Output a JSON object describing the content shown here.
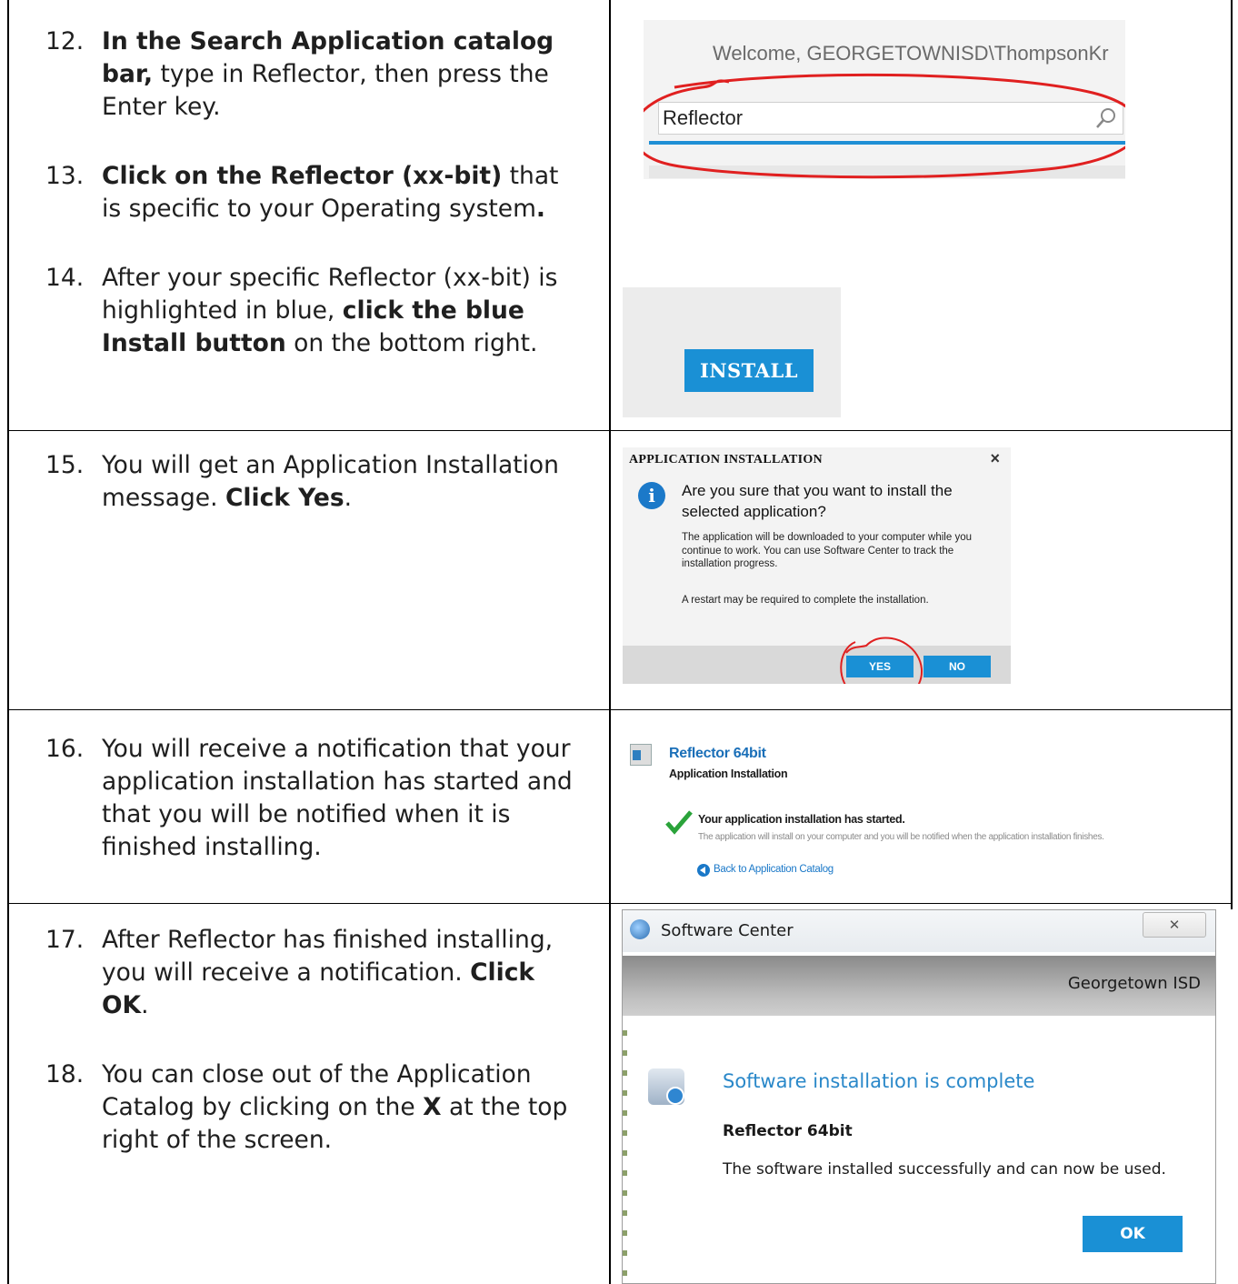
{
  "steps": {
    "s12": {
      "num": "12.",
      "bold": "In the Search Application catalog bar,",
      "rest": " type in Reflector, then press the Enter key."
    },
    "s13": {
      "num": "13.",
      "bold": "Click on the Reflector (xx-bit)",
      "rest": " that is specific to your Operating system",
      "end": "."
    },
    "s14": {
      "num": "14.",
      "pre": "After your specific Reflector (xx-bit) is highlighted in blue, ",
      "bold": "click the blue Install button",
      "rest": " on the bottom right."
    },
    "s15": {
      "num": "15.",
      "pre": "You will get an Application Installation message.  ",
      "bold": "Click Yes",
      "rest": "."
    },
    "s16": {
      "num": "16.",
      "text": "You will receive a notification that your application installation has started and that you will be notified when it is finished installing."
    },
    "s17": {
      "num": "17.",
      "pre": "After Reflector has finished installing, you will receive a notification.  ",
      "bold": "Click OK",
      "rest": "."
    },
    "s18": {
      "num": "18.",
      "pre": "You can close out of the Application Catalog by clicking on the ",
      "bold": "X",
      "rest": " at the top right of the screen."
    }
  },
  "search_shot": {
    "welcome": "Welcome, GEORGETOWNISD\\ThompsonKr",
    "input_value": "Reflector",
    "accent": "#1e8fd5",
    "annotation_color": "#e02020"
  },
  "install_shot": {
    "button": "INSTALL"
  },
  "dialog_shot": {
    "title": "APPLICATION INSTALLATION",
    "close": "×",
    "icon": "i",
    "question": "Are you sure that you want to install the selected application?",
    "body": "The application will be downloaded to your computer while you continue to work. You can use Software Center to track the installation progress.",
    "restart": "A restart may be required to complete the installation.",
    "yes": "YES",
    "no": "NO"
  },
  "started_shot": {
    "app_name": "Reflector 64bit",
    "subtitle": "Application Installation",
    "message": "Your application installation has started.",
    "detail": "The application will install on your computer and you will be notified when the application installation finishes.",
    "back": "Back to Application Catalog"
  },
  "center_shot": {
    "window_title": "Software Center",
    "close": "✕",
    "org": "Georgetown ISD",
    "headline": "Software installation is complete",
    "package": "Reflector 64bit",
    "message": "The software installed successfully and can now be used.",
    "ok": "OK"
  }
}
